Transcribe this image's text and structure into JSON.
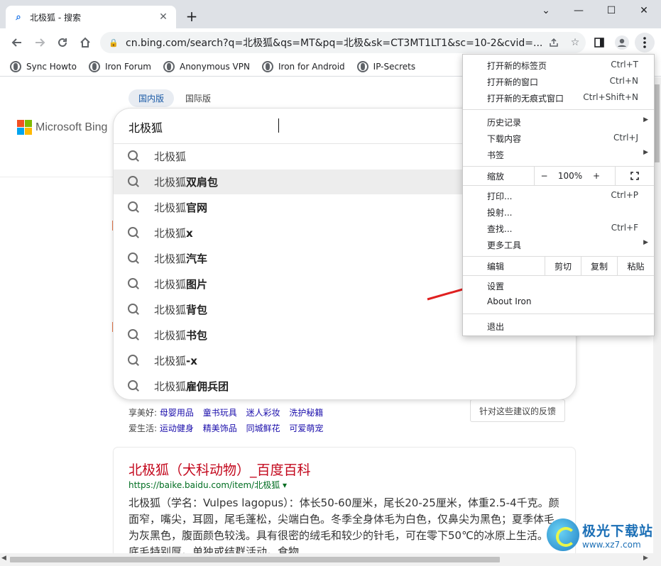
{
  "window": {
    "tab_title": "北极狐 - 搜索",
    "tab_favicon": "search-icon",
    "new_tab_label": "+",
    "controls": {
      "collapse": "⌄",
      "minimize": "—",
      "maximize": "☐",
      "close": "✕"
    }
  },
  "toolbar": {
    "url": "cn.bing.com/search?q=北极狐&qs=MT&pq=北极&sk=CT3MT1LT1&sc=10-2&cvid=..."
  },
  "bookmarks": [
    "Sync Howto",
    "Iron Forum",
    "Anonymous VPN",
    "Iron for Android",
    "IP-Secrets"
  ],
  "bing": {
    "brand": "Microsoft Bing",
    "region_tabs": [
      "国内版",
      "国际版"
    ],
    "query": "北极狐",
    "suggestions": [
      {
        "base": "北极狐",
        "bold": ""
      },
      {
        "base": "北极狐",
        "bold": "双肩包"
      },
      {
        "base": "北极狐",
        "bold": "官网"
      },
      {
        "base": "北极狐",
        "bold": "x"
      },
      {
        "base": "北极狐",
        "bold": "汽车"
      },
      {
        "base": "北极狐",
        "bold": "图片"
      },
      {
        "base": "北极狐",
        "bold": "背包"
      },
      {
        "base": "北极狐",
        "bold": "书包"
      },
      {
        "base": "北极狐",
        "bold": "-x"
      },
      {
        "base": "北极狐",
        "bold": "雇佣兵团"
      }
    ],
    "related": [
      {
        "label": "享美好:",
        "links": [
          "母婴用品",
          "童书玩具",
          "迷人彩妆",
          "洗护秘籍"
        ]
      },
      {
        "label": "爱生活:",
        "links": [
          "运动健身",
          "精美饰品",
          "同城鲜花",
          "可爱萌宠"
        ]
      }
    ],
    "feedback": "针对这些建议的反馈",
    "result": {
      "title": "北极狐（犬科动物）_百度百科",
      "url": "https://baike.baidu.com/item/北极狐 ▾",
      "snippet": "北极狐（学名：Vulpes lagopus）：体长50-60厘米，尾长20-25厘米，体重2.5-4千克。颜面窄，嘴尖，耳圆，尾毛蓬松，尖端白色。冬季全身体毛为白色，仅鼻尖为黑色；夏季体毛为灰黑色，腹面颜色较浅。具有很密的绒毛和较少的针毛，可在零下50℃的冰原上生活。足底毛特别厚。单独或结群活动。食物 ..."
    }
  },
  "menu": {
    "new_tab": {
      "label": "打开新的标签页",
      "shortcut": "Ctrl+T"
    },
    "new_window": {
      "label": "打开新的窗口",
      "shortcut": "Ctrl+N"
    },
    "incognito": {
      "label": "打开新的无痕式窗口",
      "shortcut": "Ctrl+Shift+N"
    },
    "history": {
      "label": "历史记录"
    },
    "downloads": {
      "label": "下载内容",
      "shortcut": "Ctrl+J"
    },
    "bookmarks": {
      "label": "书签"
    },
    "zoom": {
      "label": "缩放",
      "minus": "−",
      "value": "100%",
      "plus": "+",
      "fullscreen": "⛶"
    },
    "print": {
      "label": "打印...",
      "shortcut": "Ctrl+P"
    },
    "cast": {
      "label": "投射..."
    },
    "find": {
      "label": "查找...",
      "shortcut": "Ctrl+F"
    },
    "more_tools": {
      "label": "更多工具"
    },
    "edit": {
      "label": "编辑",
      "cut": "剪切",
      "copy": "复制",
      "paste": "粘贴"
    },
    "settings": {
      "label": "设置"
    },
    "about": {
      "label": "About Iron"
    },
    "exit": {
      "label": "退出"
    }
  },
  "watermark": {
    "line1": "极光下载站",
    "line2": "www.xz7.com"
  },
  "colors": {
    "bing_red": "#f25022",
    "bing_green": "#7fba00",
    "bing_blue": "#00a4ef",
    "bing_yellow": "#ffb900",
    "result_title": "#c3071c",
    "link": "#1a0dab",
    "arrow": "#e02020"
  }
}
